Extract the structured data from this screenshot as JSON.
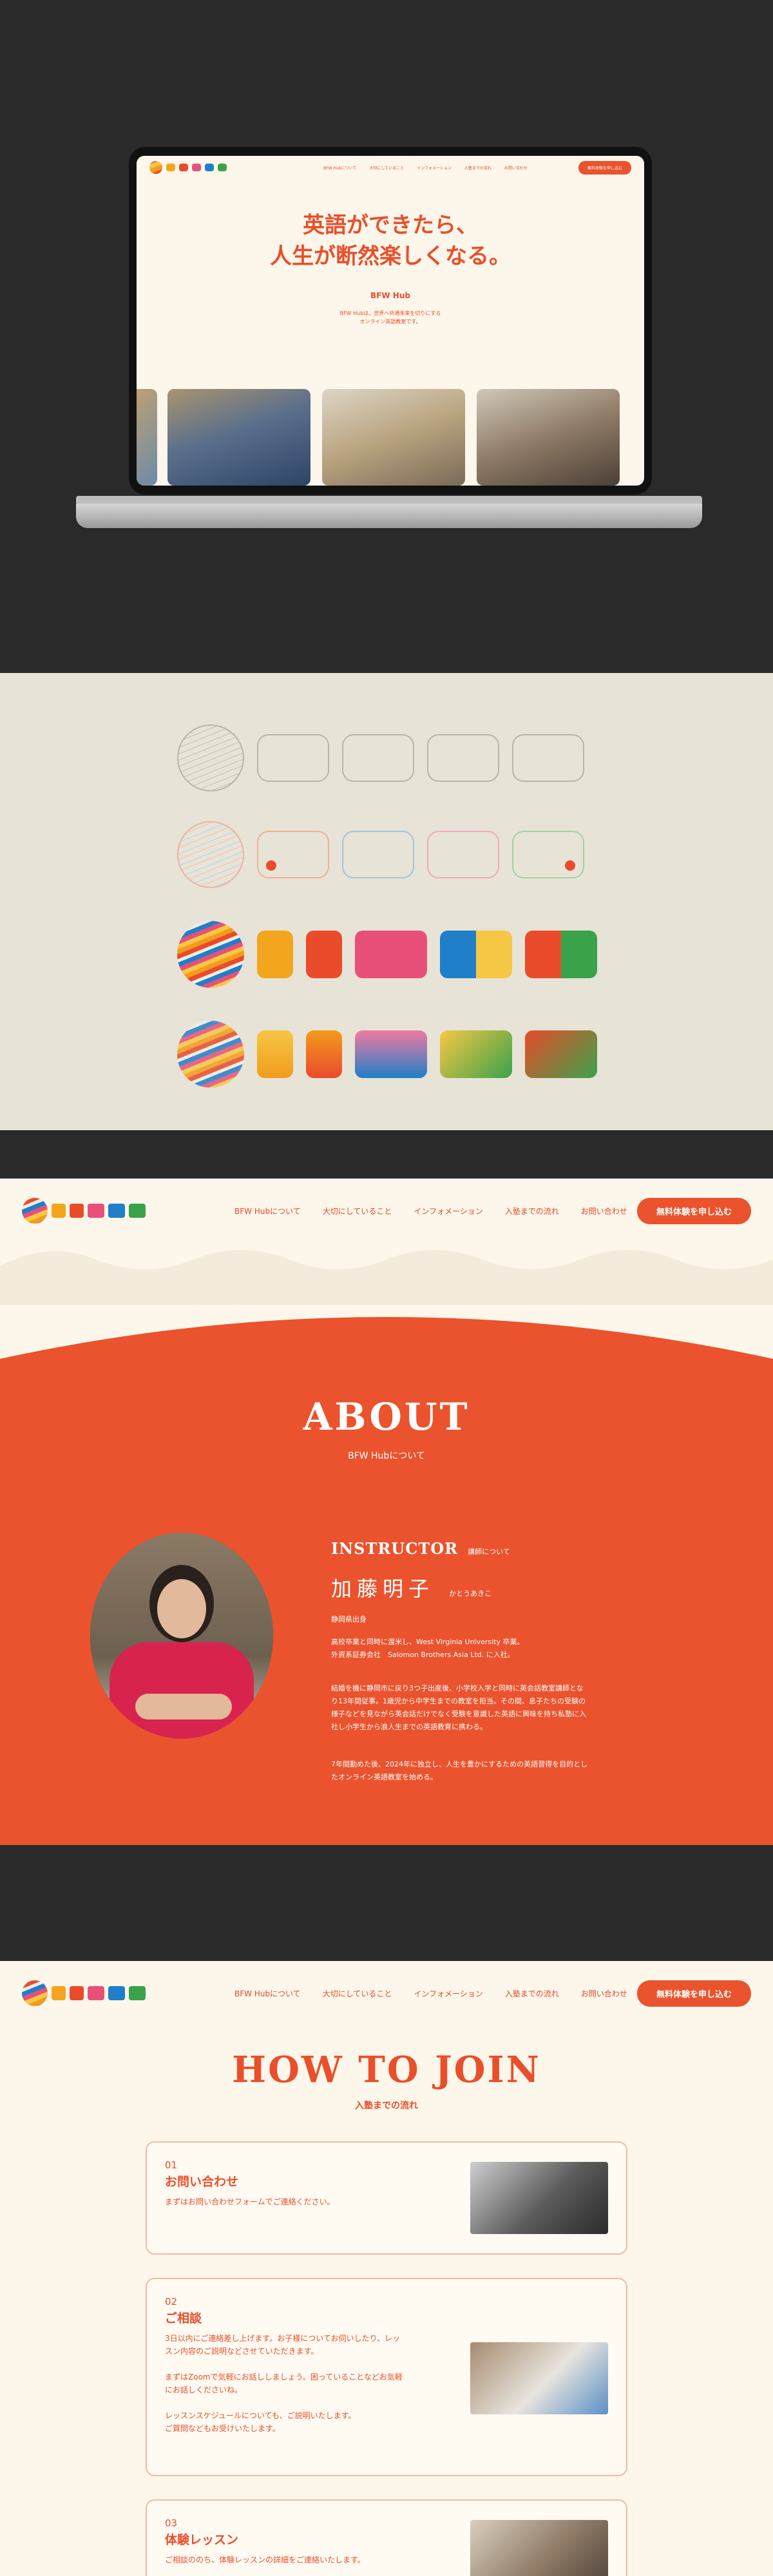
{
  "logo": {
    "text": "BFW Hub"
  },
  "nav": {
    "items": [
      "BFW Hubについて",
      "大切にしていること",
      "インフォメーション",
      "入塾までの流れ",
      "お問い合わせ"
    ],
    "cta": "無料体験を申し込む"
  },
  "hero": {
    "title_line1": "英語ができたら、",
    "title_line2": "人生が断然楽しくなる。",
    "brand": "BFW Hub",
    "desc_line1": "BFW Hubは、世界へ共通未来を切りにする",
    "desc_line2": "オンライン英語教室です。"
  },
  "about": {
    "title": "ABOUT",
    "subtitle": "BFW Hubについて",
    "instructor_label": "INSTRUCTOR",
    "instructor_sub": "講師について",
    "name": "加藤明子",
    "kana": "かとうあきこ",
    "origin": "静岡県出身",
    "bio1": "高校卒業と同時に渡米し、West Virginia University 卒業。",
    "bio2": "外資系証券会社　Salomon Brothers Asia Ltd. に入社。",
    "bio3": "結婚を機に静岡市に戻り3つ子出産後、小学校入学と同時に英会話教室講師とな",
    "bio4": "り13年間従事。1歳児から中学生までの教室を担当。その間、息子たちの受験の",
    "bio5": "様子などを見ながら英会話だけでなく受験を意識した英語に興味を持ち私塾に入",
    "bio6": "社し小学生から浪人生までの英語教育に携わる。",
    "bio7": "7年間勤めた後、2024年に独立し、人生を豊かにするための英語習得を目的とし",
    "bio8": "たオンライン英語教室を始める。"
  },
  "join": {
    "title": "HOW TO JOIN",
    "subtitle": "入塾までの流れ",
    "steps": [
      {
        "num": "01",
        "title": "お問い合わせ",
        "lines": [
          "まずはお問い合わせフォームでご連絡ください。"
        ]
      },
      {
        "num": "02",
        "title": "ご相談",
        "lines": [
          "3日以内にご連絡差し上げます。お子様についてお伺いしたり、レッ",
          "スン内容のご説明などさせていただきます。",
          "",
          "まずはZoomで気軽にお話ししましょう。困っていることなどお気軽",
          "にお話しくださいね。",
          "",
          "レッスンスケジュールについても、ご説明いたします。",
          "ご質問などもお受けいたします。"
        ]
      },
      {
        "num": "03",
        "title": "体験レッスン",
        "lines": [
          "ご相談ののち、体験レッスンの詳細をご連絡いたします。"
        ]
      }
    ]
  },
  "colors": {
    "accent": "#ea532d",
    "cream": "#fdf6ea",
    "beige": "#e7e3d6",
    "dark": "#2a2a2a"
  }
}
